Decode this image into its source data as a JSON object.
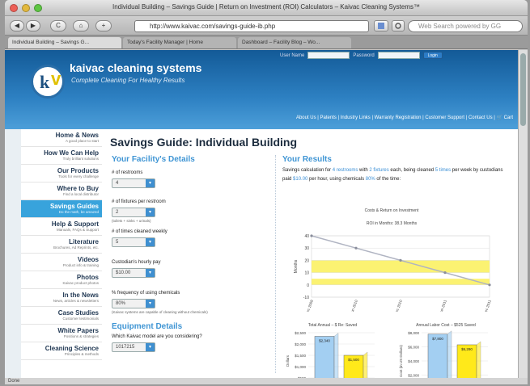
{
  "window": {
    "title": "Individual Building – Savings Guide | Return on Investment (ROI) Calculators – Kaivac Cleaning Systems™",
    "lights": [
      "#ed5f57",
      "#e3b93e",
      "#5ec643"
    ]
  },
  "toolbar": {
    "back": "◀",
    "forward": "▶",
    "refresh": "C",
    "home": "⌂",
    "add": "+",
    "url": "http://www.kaivac.com/savings-guide-ib.php",
    "search_placeholder": "Web Search powered by GG"
  },
  "tabs": [
    {
      "label": "Individual Building – Savings G...",
      "active": true
    },
    {
      "label": "Today's Facility Manager | Home",
      "active": false
    },
    {
      "label": "Dashboard – Facility Blog – Wo...",
      "active": false
    }
  ],
  "header": {
    "brand": "kaivac cleaning systems",
    "tagline": "Complete Cleaning For Healthy Results",
    "login": {
      "user_label": "User Name",
      "pass_label": "Password",
      "button": "Login"
    },
    "toplinks": "About Us | Patents | Industry Links | Warranty Registration | Customer Support | Contact Us | 🛒 Cart"
  },
  "sidebar": [
    {
      "h": "Home & News",
      "s": "A good place to start"
    },
    {
      "h": "How We Can Help",
      "s": "Truly brilliant solutions"
    },
    {
      "h": "Our Products",
      "s": "Tools for every challenge"
    },
    {
      "h": "Where to Buy",
      "s": "Find a local distributor"
    },
    {
      "h": "Savings Guides",
      "s": "Do the math, be amazed"
    },
    {
      "h": "Help & Support",
      "s": "Manuals, FAQs & Support"
    },
    {
      "h": "Literature",
      "s": "Brochures, Ad Reprints, etc."
    },
    {
      "h": "Videos",
      "s": "Product info & training"
    },
    {
      "h": "Photos",
      "s": "Kaivac product photos"
    },
    {
      "h": "In the News",
      "s": "News, articles & newsletters"
    },
    {
      "h": "Case Studies",
      "s": "Customer testimonials"
    },
    {
      "h": "White Papers",
      "s": "Positions & strategies"
    },
    {
      "h": "Cleaning Science",
      "s": "Principles & methods"
    }
  ],
  "page": {
    "title": "Savings Guide: Individual Building",
    "facility_heading": "Your Facility's Details",
    "restrooms_label": "# of restrooms",
    "restrooms_value": "4",
    "fixtures_label": "# of fixtures per restroom",
    "fixtures_value": "2",
    "fixtures_note": "(toilets + sinks + urinals)",
    "times_label": "# of times cleaned weekly",
    "times_value": "5",
    "pay_label": "Custodian's hourly pay",
    "pay_value": "$10.00",
    "chem_label": "% frequency of using chemicals",
    "chem_value": "80%",
    "chem_note": "(Kaivac systems are capable of cleaning without chemicals)",
    "equip_heading": "Equipment Details",
    "model_label": "Which Kaivac model are you considering?",
    "model_value": "1017215",
    "results_heading": "Your Results",
    "results_intro": [
      {
        "t": "Savings calculation for ",
        "h": false
      },
      {
        "t": "4 restrooms",
        "h": true
      },
      {
        "t": " with ",
        "h": false
      },
      {
        "t": "2 fixtures",
        "h": true
      },
      {
        "t": " each, being cleaned ",
        "h": false
      },
      {
        "t": "5 times",
        "h": true
      },
      {
        "t": " per week by custodians paid ",
        "h": false
      },
      {
        "t": "$10.00",
        "h": true
      },
      {
        "t": " per hour, using chemicals ",
        "h": false
      },
      {
        "t": "80%",
        "h": true
      },
      {
        "t": " of the time:",
        "h": false
      }
    ]
  },
  "chart_data": [
    {
      "type": "line",
      "title": "Costs & Return on Investment",
      "subtitle": "ROI in Months: 38.3 Months",
      "xlabel": "",
      "ylabel": "Months",
      "x": [
        "Dec 2009",
        "Jun 2010",
        "Dec 2010",
        "Jun 2011",
        "Dec 2011"
      ],
      "y": [
        40,
        30,
        20,
        10,
        0
      ],
      "ylim": [
        -10,
        40
      ],
      "yticks": [
        -10,
        0,
        10,
        20,
        30,
        40
      ],
      "bands": [
        [
          10,
          20
        ],
        [
          0,
          5
        ]
      ],
      "colors": {
        "line": "#b0b4c2",
        "band": "#fbf272",
        "point": "#8a8e9c"
      }
    },
    {
      "type": "bar",
      "title": "Total Annual – $ Re: Saved",
      "ylabel": "Dollars",
      "categories": [
        "A",
        "B"
      ],
      "values": [
        2340,
        1500
      ],
      "data_labels": [
        "$2,340",
        "$1,500"
      ],
      "ylim": [
        0,
        2500
      ],
      "yticks": [
        0,
        500,
        1000,
        1500,
        2000,
        2500
      ],
      "colors": [
        "#a3cff2",
        "#ffe91a"
      ]
    },
    {
      "type": "bar",
      "title": "Annual Labor Cost – $525 Saved",
      "ylabel": "Cost (in US Dollars)",
      "categories": [
        "A",
        "B"
      ],
      "values": [
        7800,
        6290
      ],
      "data_labels": [
        "$7,800",
        "$6,290"
      ],
      "ylim": [
        0,
        8000
      ],
      "yticks": [
        0,
        2000,
        4000,
        6000,
        8000
      ],
      "colors": [
        "#a3cff2",
        "#ffe91a"
      ]
    }
  ],
  "statusbar": "Done"
}
